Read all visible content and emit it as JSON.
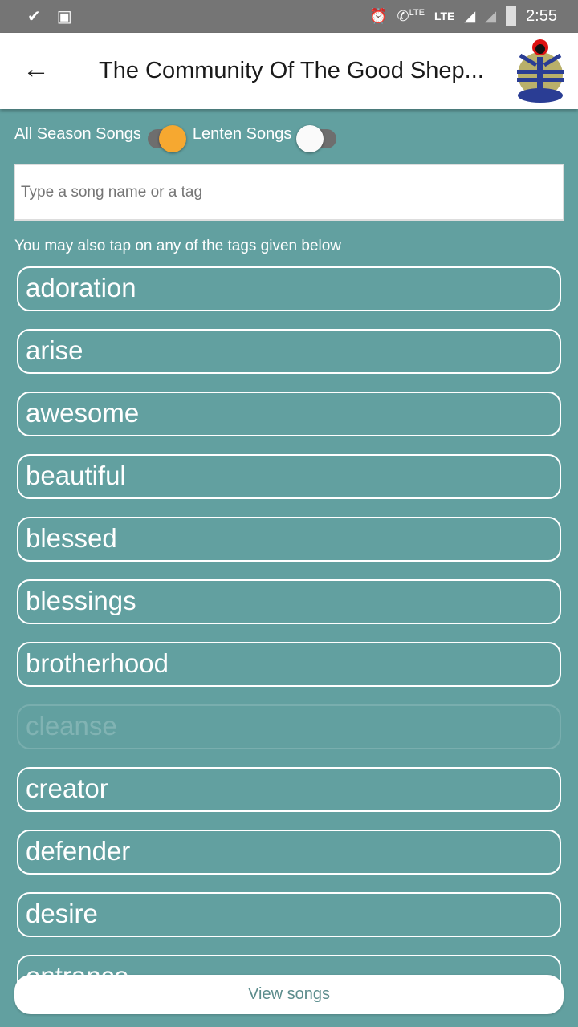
{
  "status_bar": {
    "time": "2:55",
    "lte1": "LTE",
    "lte2": "LTE",
    "icons": [
      "download-done-icon",
      "image-icon",
      "alarm-icon",
      "volte-call-icon",
      "signal-icon",
      "signal-empty-icon",
      "battery-icon"
    ]
  },
  "app_bar": {
    "title": "The Community Of The Good Shep...",
    "back_icon": "arrow-left-icon",
    "logo": "community-logo"
  },
  "switches": [
    {
      "label": "All Season Songs",
      "on": true,
      "color": "#f6a830"
    },
    {
      "label": "Lenten Songs",
      "on": false,
      "color": "#fafafa"
    }
  ],
  "search": {
    "placeholder": "Type a song name or a tag",
    "value": ""
  },
  "hint": "You may also tap on any of the tags given below",
  "tags": [
    "adoration",
    "arise",
    "awesome",
    "beautiful",
    "blessed",
    "blessings",
    "brotherhood",
    "cleanse",
    "creator",
    "defender",
    "desire",
    "entrance"
  ],
  "faded_tag": "cleanse",
  "view_button": "View songs"
}
